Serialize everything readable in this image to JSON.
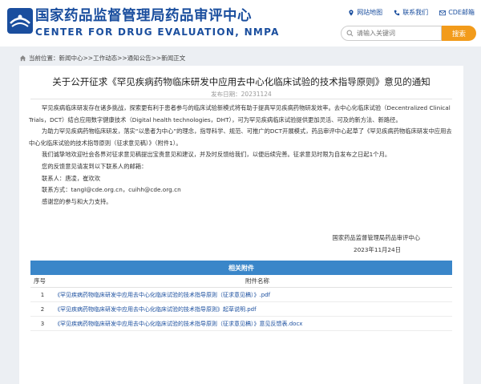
{
  "header": {
    "title": "国家药品监督管理局药品审评中心",
    "subtitle": "CENTER FOR DRUG EVALUATION, NMPA",
    "links": [
      {
        "label": "网站地图",
        "icon": "map-pin-icon"
      },
      {
        "label": "联系我们",
        "icon": "phone-icon"
      },
      {
        "label": "CDE邮箱",
        "icon": "mail-icon"
      }
    ],
    "search": {
      "placeholder": "请输入关键词",
      "button": "搜索"
    }
  },
  "breadcrumb": {
    "text": "当前位置：新闻中心>>工作动态>>通知公告>>新闻正文"
  },
  "article": {
    "title": "关于公开征求《罕见疾病药物临床研发中应用去中心化临床试验的技术指导原则》意见的通知",
    "date": "发布日期：20231124",
    "paragraphs": [
      "罕见疾病临床研发存在诸多挑战，探索更有利于患者参与的临床试验新模式将有助于提高罕见疾病药物研发效率。去中心化临床试验（Decentralized Clinical Trials，DCT）结合应用数字健康技术（Digital health technologies，DHT），可为罕见疾病临床试验提供更加灵活、可及的新方法、新路径。",
      "为助力罕见疾病药物临床研发，落实“以患者为中心”的理念，指导科学、规范、可推广的DCT开展模式，药品审评中心起草了《罕见疾病药物临床研发中应用去中心化临床试验的技术指导原则（征求意见稿）》（附件1）。",
      "我们诚挚地欢迎社会各界对征求意见稿提出宝贵意见和建议，并及时反馈给我们，以便后续完善。征求意见时限为自发布之日起1个月。",
      "您的反馈意见请发到以下联系人的邮箱：",
      "联系人：唐凌，崔欢欢",
      "联系方式：tangl@cde.org.cn，cuihh@cde.org.cn",
      "感谢您的参与和大力支持。"
    ],
    "signature_org": "国家药品监督管理局药品审评中心",
    "signature_date": "2023年11月24日"
  },
  "attachments": {
    "header": "相关附件",
    "col_no": "序号",
    "col_name": "附件名称",
    "items": [
      {
        "no": "1",
        "name": "《罕见疾病药物临床研发中应用去中心化临床试验的技术指导原则（征求意见稿）》.pdf"
      },
      {
        "no": "2",
        "name": "《罕见疾病药物临床研发中应用去中心化临床试验的技术指导原则》起草说明.pdf"
      },
      {
        "no": "3",
        "name": "《罕见疾病药物临床研发中应用去中心化临床试验的技术指导原则（征求意见稿）》意见反馈表.docx"
      }
    ]
  },
  "colors": {
    "brand": "#1a4e9e",
    "accent": "#f29b1b",
    "attach_header": "#3a86c9"
  }
}
